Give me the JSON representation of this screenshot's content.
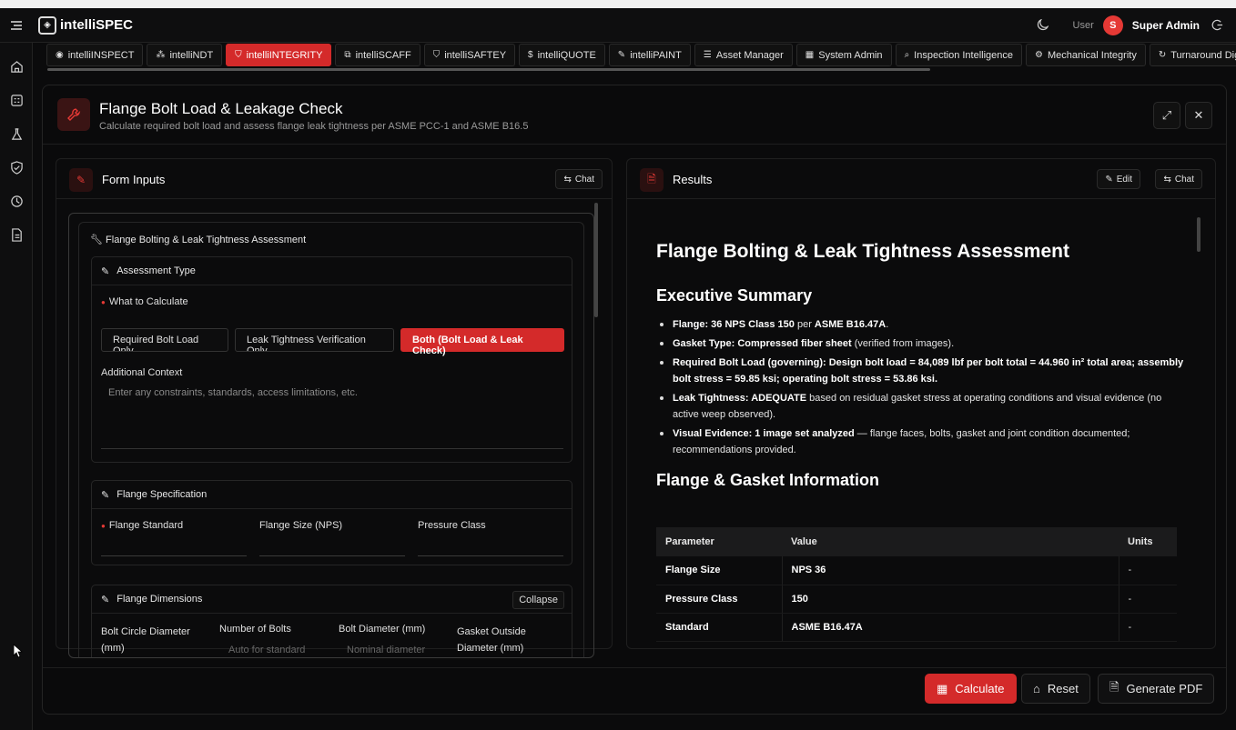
{
  "header": {
    "brand": "intelliSPEC",
    "role": "User",
    "avatar_initial": "S",
    "user_name": "Super Admin"
  },
  "tabs": [
    {
      "label": "intelliINSPECT",
      "icon": "eye-icon",
      "active": false
    },
    {
      "label": "intelliNDT",
      "icon": "network-icon",
      "active": false
    },
    {
      "label": "intelliINTEGRITY",
      "icon": "shield-icon",
      "active": true
    },
    {
      "label": "intelliSCAFF",
      "icon": "scaffold-icon",
      "active": false
    },
    {
      "label": "intelliSAFTEY",
      "icon": "shield-icon",
      "active": false
    },
    {
      "label": "intelliQUOTE",
      "icon": "dollar-icon",
      "active": false
    },
    {
      "label": "intelliPAINT",
      "icon": "paint-icon",
      "active": false
    },
    {
      "label": "Asset Manager",
      "icon": "list-icon",
      "active": false
    },
    {
      "label": "System Admin",
      "icon": "grid-icon",
      "active": false
    },
    {
      "label": "Inspection Intelligence",
      "icon": "search-icon",
      "active": false
    },
    {
      "label": "Mechanical Integrity",
      "icon": "gear-icon",
      "active": false
    },
    {
      "label": "Turnaround Digital",
      "icon": "refresh-icon",
      "active": false
    }
  ],
  "main": {
    "title": "Flange Bolt Load & Leakage Check",
    "subtitle": "Calculate required bolt load and assess flange leak tightness per ASME PCC-1 and ASME B16.5"
  },
  "form": {
    "panel_title": "Form Inputs",
    "chat_label": "Chat",
    "section_title": "Flange Bolting & Leak Tightness Assessment",
    "assessment": {
      "title": "Assessment Type",
      "what_label": "What to Calculate",
      "options": [
        "Required Bolt Load Only",
        "Leak Tightness Verification Only",
        "Both (Bolt Load & Leak Check)"
      ],
      "selected_index": 2,
      "context_label": "Additional Context",
      "context_placeholder": "Enter any constraints, standards, access limitations, etc."
    },
    "spec": {
      "title": "Flange Specification",
      "standard_label": "Flange Standard",
      "size_label": "Flange Size (NPS)",
      "class_label": "Pressure Class"
    },
    "dims": {
      "title": "Flange Dimensions",
      "collapse_label": "Collapse",
      "bcd_label": "Bolt Circle Diameter (mm)",
      "nbolts_label": "Number of Bolts",
      "nbolts_placeholder": "Auto for standard",
      "bdia_label": "Bolt Diameter (mm)",
      "bdia_placeholder": "Nominal diameter",
      "god_label": "Gasket Outside Diameter (mm)"
    }
  },
  "results": {
    "panel_title": "Results",
    "edit_label": "Edit",
    "chat_label": "Chat",
    "h1": "Flange Bolting & Leak Tightness Assessment",
    "exec_title": "Executive Summary",
    "bullets": [
      {
        "bold": "Flange: 36 NPS Class 150",
        "text": " per ",
        "bold2": "ASME B16.47A",
        "tail": "."
      },
      {
        "bold": "Gasket Type: Compressed fiber sheet",
        "text": " (verified from images).",
        "bold2": "",
        "tail": ""
      },
      {
        "bold": "Required Bolt Load (governing): Design bolt load = 84,089 lbf per bolt total = 44.960 in² total area; assembly bolt stress = 59.85 ksi; operating bolt stress = 53.86 ksi.",
        "text": "",
        "bold2": "",
        "tail": ""
      },
      {
        "bold": "Leak Tightness: ADEQUATE",
        "text": " based on residual gasket stress at operating conditions and visual evidence (no active weep observed).",
        "bold2": "",
        "tail": ""
      },
      {
        "bold": "Visual Evidence: 1 image set analyzed",
        "text": " — flange faces, bolts, gasket and joint condition documented; recommendations provided.",
        "bold2": "",
        "tail": ""
      }
    ],
    "info_title": "Flange & Gasket Information",
    "table": {
      "headers": [
        "Parameter",
        "Value",
        "Units"
      ],
      "rows": [
        [
          "Flange Size",
          "NPS 36",
          "-"
        ],
        [
          "Pressure Class",
          "150",
          "-"
        ],
        [
          "Standard",
          "ASME B16.47A",
          "-"
        ]
      ]
    }
  },
  "footer": {
    "calculate": "Calculate",
    "reset": "Reset",
    "pdf": "Generate PDF"
  },
  "colors": {
    "accent": "#d42a2a",
    "background": "#0b0b0c"
  }
}
